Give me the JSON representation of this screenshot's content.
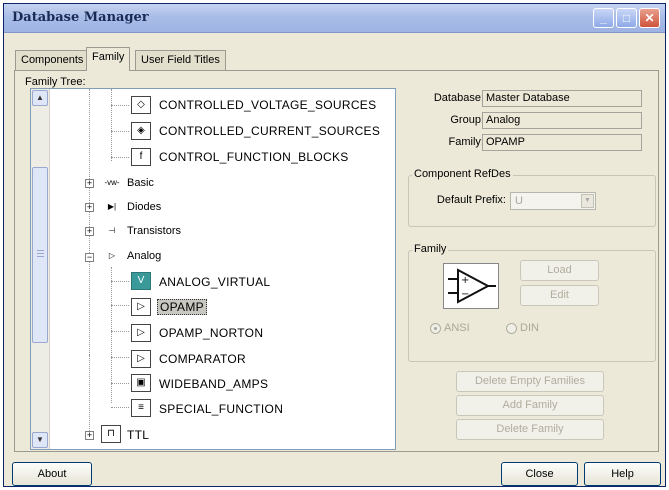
{
  "window": {
    "title": "Database Manager",
    "controls": {
      "minimize": "_",
      "maximize": "□",
      "close": "✕"
    }
  },
  "tabs": [
    {
      "label": "Components",
      "active": false
    },
    {
      "label": "Family",
      "active": true
    },
    {
      "label": "User Field Titles",
      "active": false
    }
  ],
  "tree": {
    "label": "Family Tree:",
    "scroll_up": "▲",
    "scroll_down": "▼",
    "items": [
      {
        "label": "CONTROLLED_VOLTAGE_SOURCES",
        "icon": "controlled-voltage-source-icon"
      },
      {
        "label": "CONTROLLED_CURRENT_SOURCES",
        "icon": "controlled-current-source-icon"
      },
      {
        "label": "CONTROL_FUNCTION_BLOCKS",
        "icon": "control-function-block-icon"
      },
      {
        "label": "Basic",
        "icon": "basic-group-icon",
        "expander": "+"
      },
      {
        "label": "Diodes",
        "icon": "diode-icon",
        "expander": "+"
      },
      {
        "label": "Transistors",
        "icon": "transistor-icon",
        "expander": "+"
      },
      {
        "label": "Analog",
        "icon": "analog-group-icon",
        "expander": "−"
      },
      {
        "label": "ANALOG_VIRTUAL",
        "icon": "analog-virtual-icon"
      },
      {
        "label": "OPAMP",
        "icon": "opamp-icon",
        "selected": true
      },
      {
        "label": "OPAMP_NORTON",
        "icon": "opamp-norton-icon"
      },
      {
        "label": "COMPARATOR",
        "icon": "comparator-icon"
      },
      {
        "label": "WIDEBAND_AMPS",
        "icon": "wideband-amp-icon"
      },
      {
        "label": "SPECIAL_FUNCTION",
        "icon": "special-function-icon"
      },
      {
        "label": "TTL",
        "icon": "ttl-group-icon",
        "expander": "+"
      }
    ],
    "icon_glyphs": {
      "voltage": "◇",
      "current": "◈",
      "function": "f",
      "basic": "-vw-",
      "diode": "▶|",
      "transistor": "⊣",
      "analog": "▷",
      "virtual": "V",
      "opamp": "▷",
      "comparator": "▷",
      "wideband": "▣",
      "special": "≡",
      "ttl": "⊓"
    }
  },
  "info": {
    "database_label": "Database:",
    "database_value": "Master Database",
    "group_label": "Group:",
    "group_value": "Analog",
    "family_label": "Family:",
    "family_value": "OPAMP"
  },
  "refdes": {
    "title": "Component RefDes",
    "prefix_label": "Default Prefix:",
    "prefix_value": "U",
    "dropdown_arrow": "▼"
  },
  "family_group": {
    "title": "Family",
    "symbol_glyph": "▷",
    "load_label": "Load",
    "edit_label": "Edit",
    "radio_ansi": "ANSI",
    "radio_din": "DIN"
  },
  "actions": {
    "delete_empty": "Delete Empty Families",
    "add_family": "Add Family",
    "delete_family": "Delete Family"
  },
  "footer": {
    "about": "About",
    "close": "Close",
    "help": "Help"
  },
  "colors": {
    "titlebar": "#a9bde8",
    "dialog_bg": "#ece9d8",
    "accent_teal": "#3a9a9a"
  }
}
